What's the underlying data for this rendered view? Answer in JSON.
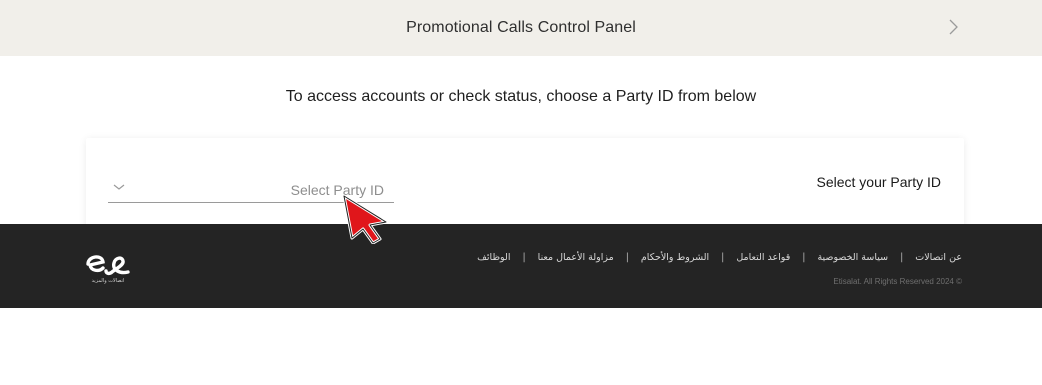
{
  "header": {
    "title": "Promotional Calls Control Panel",
    "next_icon": "chevron-right-icon"
  },
  "main": {
    "instruction": "To access accounts or check status, choose a Party ID from below",
    "party_select": {
      "label": "Select your Party ID",
      "placeholder": "Select Party ID",
      "dropdown_icon": "chevron-down-icon"
    }
  },
  "footer": {
    "links": [
      "عن اتصالات",
      "سياسة الخصوصية",
      "قواعد التعامل",
      "الشروط والأحكام",
      "مزاولة الأعمال معنا",
      "الوظائف"
    ],
    "separator": "|",
    "copyright": "Etisalat. All Rights Reserved 2024 ©",
    "logo": {
      "name": "e& logo",
      "tagline": "اتصالات والمزيد"
    }
  },
  "colors": {
    "header_bg": "#f1efea",
    "footer_bg": "#242424",
    "cursor_fill": "#e0161b"
  }
}
